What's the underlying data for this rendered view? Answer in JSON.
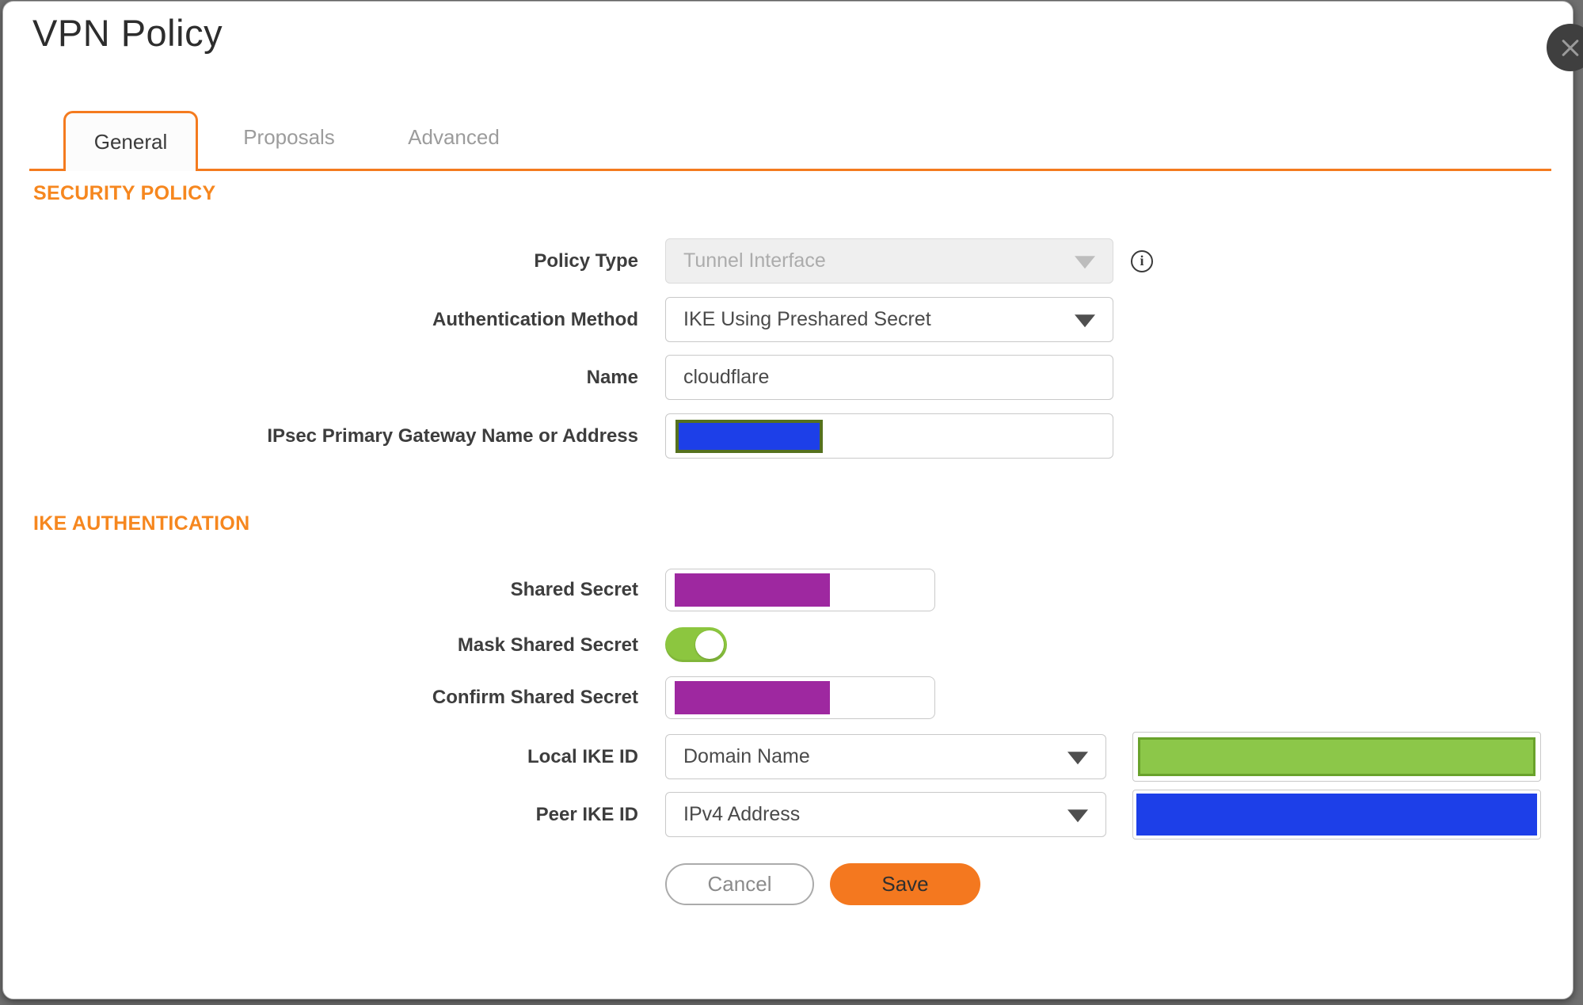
{
  "window": {
    "title": "VPN Policy"
  },
  "tabs": [
    {
      "label": "General",
      "active": true
    },
    {
      "label": "Proposals",
      "active": false
    },
    {
      "label": "Advanced",
      "active": false
    }
  ],
  "sections": {
    "security_policy": "SECURITY POLICY",
    "ike_authentication": "IKE AUTHENTICATION"
  },
  "fields": {
    "policy_type": {
      "label": "Policy Type",
      "value": "Tunnel Interface",
      "disabled": true,
      "info_glyph": "i"
    },
    "authentication_method": {
      "label": "Authentication Method",
      "value": "IKE Using Preshared Secret"
    },
    "name": {
      "label": "Name",
      "value": "cloudflare"
    },
    "ipsec_primary_gateway": {
      "label": "IPsec Primary Gateway Name or Address",
      "value_redacted": "blue"
    },
    "shared_secret": {
      "label": "Shared Secret",
      "value_redacted": "purple"
    },
    "mask_shared_secret": {
      "label": "Mask Shared Secret",
      "toggle_on": true
    },
    "confirm_shared_secret": {
      "label": "Confirm Shared Secret",
      "value_redacted": "purple"
    },
    "local_ike_id": {
      "label": "Local IKE ID",
      "value": "Domain Name",
      "extra_redacted": "green"
    },
    "peer_ike_id": {
      "label": "Peer IKE ID",
      "value": "IPv4 Address",
      "extra_redacted": "blue"
    }
  },
  "buttons": {
    "cancel": "Cancel",
    "save": "Save"
  },
  "colors": {
    "accent_orange": "#F4781F",
    "header_orange": "#F6871F",
    "toggle_green": "#8CC63F",
    "redaction_purple": "#9E28A0",
    "redaction_blue": "#1D3FE8",
    "redaction_blue_border": "#55711E",
    "redaction_green": "#8CC749",
    "redaction_green_border": "#69A22B",
    "backdrop_gray": "#6F6F6F",
    "close_button_gray": "#3F3F3F"
  }
}
